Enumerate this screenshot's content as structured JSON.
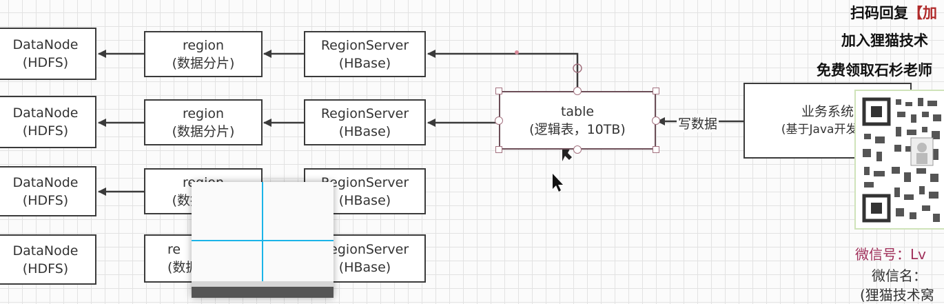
{
  "diagram": {
    "rows": [
      {
        "datanode": {
          "line1": "DataNode",
          "line2": "(HDFS)"
        },
        "region": {
          "line1": "region",
          "line2": "(数据分片)"
        },
        "server": {
          "line1": "RegionServer",
          "line2": "(HBase)"
        }
      },
      {
        "datanode": {
          "line1": "DataNode",
          "line2": "(HDFS)"
        },
        "region": {
          "line1": "region",
          "line2": "(数据分片)"
        },
        "server": {
          "line1": "RegionServer",
          "line2": "(HBase)"
        }
      },
      {
        "datanode": {
          "line1": "DataNode",
          "line2": "(HDFS)"
        },
        "region": {
          "line1": "region",
          "line2": "(数据分片)"
        },
        "server": {
          "line1": "RegionServer",
          "line2": "(HBase)"
        }
      },
      {
        "datanode": {
          "line1": "DataNode",
          "line2": "(HDFS)"
        },
        "region": {
          "line1": "re",
          "line2": "(数据"
        },
        "server": {
          "line1": "RegionServer",
          "line2": "(HBase)"
        }
      }
    ],
    "table": {
      "line1": "table",
      "line2": "(逻辑表，10TB)"
    },
    "business": {
      "line1": "业务系统",
      "line2": "(基于Java开发的)"
    },
    "edge_label": "写数据",
    "colors": {
      "stroke": "#3a3a3a",
      "selection": "#a2707e",
      "crosshair": "#1ab4e8"
    }
  },
  "promo": {
    "line1": "扫码回复",
    "line1_bracket": "【加",
    "line2": "加入狸猫技术",
    "line3": "免费领取石杉老师",
    "wechat_id_label": "微信号：Lv",
    "wechat_name_label": "微信名：",
    "wechat_name_sub": "(狸猫技术窝",
    "colors": {
      "bracket": "#b02a2a",
      "wechat_id": "#a0305a",
      "qr_frame": "#cfe3b9"
    }
  }
}
